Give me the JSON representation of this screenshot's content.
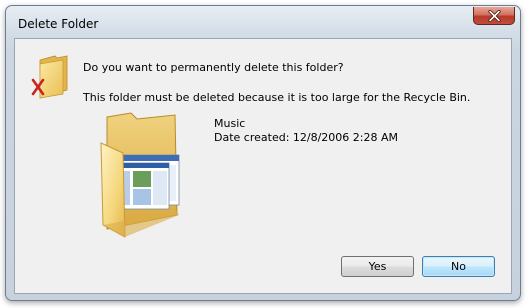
{
  "window": {
    "title": "Delete Folder"
  },
  "dialog": {
    "question": "Do you want to permanently delete this folder?",
    "reason": "This folder must be deleted because it is too large for the Recycle Bin.",
    "item": {
      "name": "Music",
      "date_created": "Date created: 12/8/2006 2:28 AM"
    }
  },
  "buttons": {
    "yes": "Yes",
    "no": "No"
  },
  "icons": {
    "close": "close-icon",
    "dialog": "folder-delete-icon",
    "item": "folder-icon"
  },
  "colors": {
    "close_button": "#c44d3a",
    "default_button_border": "#3c7fb1",
    "folder": "#f3d27a"
  }
}
